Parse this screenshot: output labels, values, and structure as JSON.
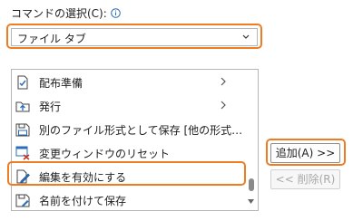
{
  "command_label": "コマンドの選択(C):",
  "dropdown": {
    "selected": "ファイル タブ"
  },
  "list_items": [
    {
      "label": "配布準備",
      "icon": "document-prepare-icon",
      "submenu": true
    },
    {
      "label": "発行",
      "icon": "publish-icon",
      "submenu": true
    },
    {
      "label": "別のファイル形式として保存 [他の形式…",
      "icon": "save-as-other-format-icon",
      "submenu": false
    },
    {
      "label": "変更ウィンドウのリセット",
      "icon": "reset-window-icon",
      "submenu": false
    },
    {
      "label": "編集を有効にする",
      "icon": "enable-editing-icon",
      "submenu": false
    },
    {
      "label": "名前を付けて保存",
      "icon": "save-as-icon",
      "submenu": false
    }
  ],
  "buttons": {
    "add": "追加(A) >>",
    "remove": "<< 削除(R)"
  },
  "colors": {
    "highlight": "#f07c22",
    "icon_blue": "#2a6ebb",
    "icon_red": "#c0392b"
  }
}
